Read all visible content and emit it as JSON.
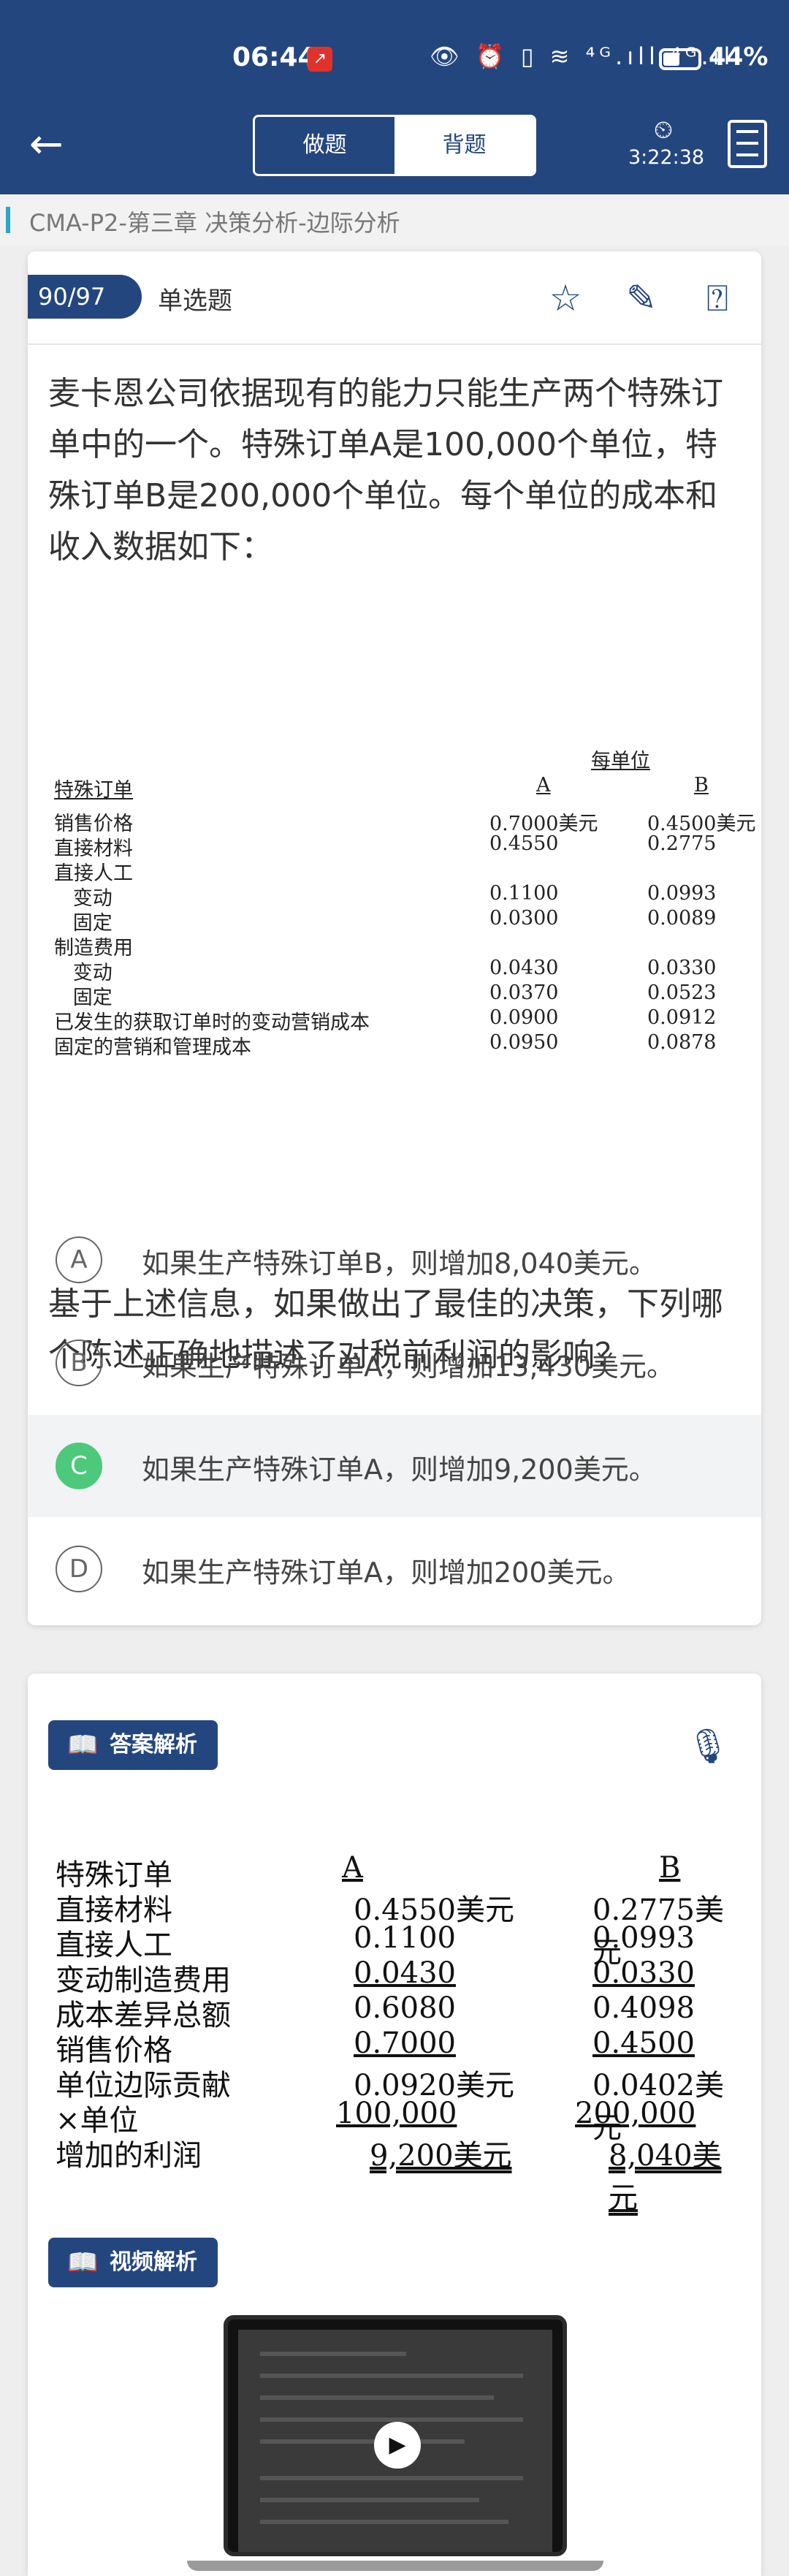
{
  "status_bar": {
    "time": "06:44",
    "signal": "⁴ᴳ.ıll ⁴ᴳ.ıll",
    "battery_percent": "44%"
  },
  "header": {
    "back_icon": "arrow-left-icon",
    "tabs": [
      {
        "label": "做题",
        "active": true
      },
      {
        "label": "背题",
        "active": false
      }
    ],
    "timer": "3:22:38"
  },
  "breadcrumb": "CMA-P2-第三章 决策分析-边际分析",
  "question": {
    "number": "90/97",
    "type": "单选题",
    "text": "麦卡恩公司依据现有的能力只能生产两个特殊订单中的一个。特殊订单A是100,000个单位，特殊订单B是200,000个单位。每个单位的成本和收入数据如下：",
    "table": {
      "per_unit_header": "每单位",
      "header": {
        "label": "特殊订单",
        "a": "A",
        "b": "B"
      },
      "rows": [
        {
          "label": "销售价格",
          "a": "0.7000美元",
          "b": "0.4500美元"
        },
        {
          "label": "直接材料",
          "a": "0.4550",
          "b": "0.2775"
        },
        {
          "label": "直接人工",
          "a": "",
          "b": ""
        },
        {
          "label": "   变动",
          "a": "0.1100",
          "b": "0.0993"
        },
        {
          "label": "   固定",
          "a": "0.0300",
          "b": "0.0089"
        },
        {
          "label": "制造费用",
          "a": "",
          "b": ""
        },
        {
          "label": "   变动",
          "a": "0.0430",
          "b": "0.0330"
        },
        {
          "label": "   固定",
          "a": "0.0370",
          "b": "0.0523"
        },
        {
          "label": "已发生的获取订单时的变动营销成本",
          "a": "0.0900",
          "b": "0.0912"
        },
        {
          "label": "固定的营销和管理成本",
          "a": "0.0950",
          "b": "0.0878"
        }
      ]
    },
    "prompt": "基于上述信息，如果做出了最佳的决策，下列哪个陈述正确地描述了对税前利润的影响？",
    "options": [
      {
        "letter": "A",
        "text": "如果生产特殊订单B，则增加8,040美元。",
        "selected": false
      },
      {
        "letter": "B",
        "text": "如果生产特殊订单A，则增加13,430美元。",
        "selected": false
      },
      {
        "letter": "C",
        "text": "如果生产特殊订单A，则增加9,200美元。",
        "selected": true
      },
      {
        "letter": "D",
        "text": "如果生产特殊订单A，则增加200美元。",
        "selected": false
      }
    ]
  },
  "analysis": {
    "title": "答案解析",
    "table": {
      "header": {
        "label": "特殊订单",
        "a": "A",
        "b": "B"
      },
      "rows": [
        {
          "label": "直接材料",
          "a": "0.4550美元",
          "b": "0.2775美元"
        },
        {
          "label": "直接人工",
          "a": "0.1100",
          "b": "0.0993"
        },
        {
          "label": "变动制造费用",
          "a": "0.0430",
          "b": "0.0330"
        },
        {
          "label": "成本差异总额",
          "a": "0.6080",
          "b": "0.4098"
        },
        {
          "label": "销售价格",
          "a": "0.7000",
          "b": "0.4500"
        },
        {
          "label": "单位边际贡献",
          "a": "0.0920美元",
          "b": "0.0402美元"
        },
        {
          "label": "×单位",
          "a": "100,000",
          "b": "200,000"
        },
        {
          "label": "增加的利润",
          "a": "9,200美元",
          "b": "8,040美元"
        }
      ]
    },
    "video_title": "视频解析"
  },
  "colors": {
    "primary": "#24467f",
    "correct": "#4cc97a",
    "accent_bar": "#2aa7c9"
  }
}
